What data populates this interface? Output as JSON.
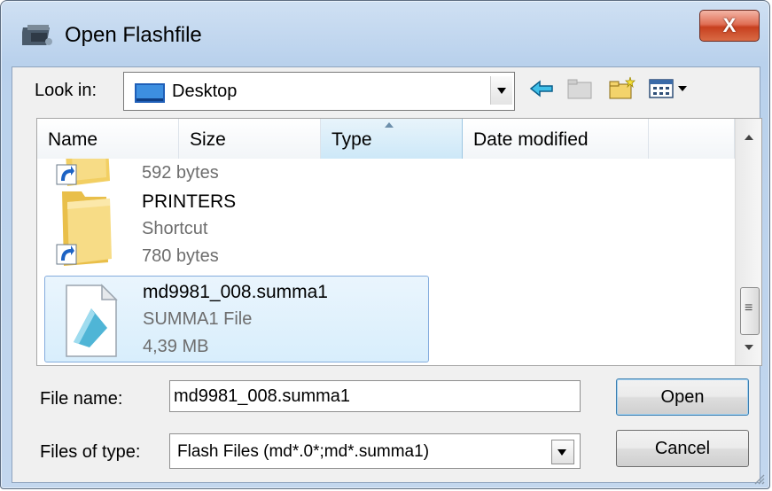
{
  "window": {
    "title": "Open Flashfile",
    "close_label": "X"
  },
  "lookin": {
    "label": "Look in:",
    "value": "Desktop"
  },
  "toolbar": [
    "back-arrow-icon",
    "up-folder-icon",
    "new-folder-icon",
    "view-menu-icon"
  ],
  "columns": [
    "Name",
    "Size",
    "Type",
    "Date modified"
  ],
  "files": [
    {
      "name": "",
      "type": "",
      "size": "592 bytes"
    },
    {
      "name": "PRINTERS",
      "type": "Shortcut",
      "size": "780 bytes"
    },
    {
      "name": "md9981_008.summa1",
      "type": "SUMMA1 File",
      "size": "4,39 MB"
    }
  ],
  "form": {
    "filename_label": "File name:",
    "filename_value": "md9981_008.summa1",
    "filetype_label": "Files of type:",
    "filetype_value": "Flash Files (md*.0*;md*.summa1)"
  },
  "buttons": {
    "open": "Open",
    "cancel": "Cancel"
  }
}
